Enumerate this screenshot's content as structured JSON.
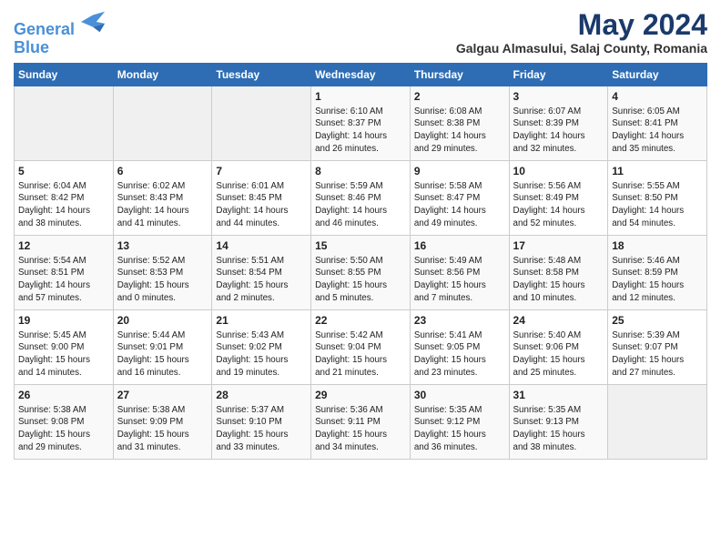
{
  "header": {
    "logo_line1": "General",
    "logo_line2": "Blue",
    "title": "May 2024",
    "subtitle": "Galgau Almasului, Salaj County, Romania"
  },
  "days_of_week": [
    "Sunday",
    "Monday",
    "Tuesday",
    "Wednesday",
    "Thursday",
    "Friday",
    "Saturday"
  ],
  "weeks": [
    [
      {
        "day": "",
        "detail": ""
      },
      {
        "day": "",
        "detail": ""
      },
      {
        "day": "",
        "detail": ""
      },
      {
        "day": "1",
        "detail": "Sunrise: 6:10 AM\nSunset: 8:37 PM\nDaylight: 14 hours\nand 26 minutes."
      },
      {
        "day": "2",
        "detail": "Sunrise: 6:08 AM\nSunset: 8:38 PM\nDaylight: 14 hours\nand 29 minutes."
      },
      {
        "day": "3",
        "detail": "Sunrise: 6:07 AM\nSunset: 8:39 PM\nDaylight: 14 hours\nand 32 minutes."
      },
      {
        "day": "4",
        "detail": "Sunrise: 6:05 AM\nSunset: 8:41 PM\nDaylight: 14 hours\nand 35 minutes."
      }
    ],
    [
      {
        "day": "5",
        "detail": "Sunrise: 6:04 AM\nSunset: 8:42 PM\nDaylight: 14 hours\nand 38 minutes."
      },
      {
        "day": "6",
        "detail": "Sunrise: 6:02 AM\nSunset: 8:43 PM\nDaylight: 14 hours\nand 41 minutes."
      },
      {
        "day": "7",
        "detail": "Sunrise: 6:01 AM\nSunset: 8:45 PM\nDaylight: 14 hours\nand 44 minutes."
      },
      {
        "day": "8",
        "detail": "Sunrise: 5:59 AM\nSunset: 8:46 PM\nDaylight: 14 hours\nand 46 minutes."
      },
      {
        "day": "9",
        "detail": "Sunrise: 5:58 AM\nSunset: 8:47 PM\nDaylight: 14 hours\nand 49 minutes."
      },
      {
        "day": "10",
        "detail": "Sunrise: 5:56 AM\nSunset: 8:49 PM\nDaylight: 14 hours\nand 52 minutes."
      },
      {
        "day": "11",
        "detail": "Sunrise: 5:55 AM\nSunset: 8:50 PM\nDaylight: 14 hours\nand 54 minutes."
      }
    ],
    [
      {
        "day": "12",
        "detail": "Sunrise: 5:54 AM\nSunset: 8:51 PM\nDaylight: 14 hours\nand 57 minutes."
      },
      {
        "day": "13",
        "detail": "Sunrise: 5:52 AM\nSunset: 8:53 PM\nDaylight: 15 hours\nand 0 minutes."
      },
      {
        "day": "14",
        "detail": "Sunrise: 5:51 AM\nSunset: 8:54 PM\nDaylight: 15 hours\nand 2 minutes."
      },
      {
        "day": "15",
        "detail": "Sunrise: 5:50 AM\nSunset: 8:55 PM\nDaylight: 15 hours\nand 5 minutes."
      },
      {
        "day": "16",
        "detail": "Sunrise: 5:49 AM\nSunset: 8:56 PM\nDaylight: 15 hours\nand 7 minutes."
      },
      {
        "day": "17",
        "detail": "Sunrise: 5:48 AM\nSunset: 8:58 PM\nDaylight: 15 hours\nand 10 minutes."
      },
      {
        "day": "18",
        "detail": "Sunrise: 5:46 AM\nSunset: 8:59 PM\nDaylight: 15 hours\nand 12 minutes."
      }
    ],
    [
      {
        "day": "19",
        "detail": "Sunrise: 5:45 AM\nSunset: 9:00 PM\nDaylight: 15 hours\nand 14 minutes."
      },
      {
        "day": "20",
        "detail": "Sunrise: 5:44 AM\nSunset: 9:01 PM\nDaylight: 15 hours\nand 16 minutes."
      },
      {
        "day": "21",
        "detail": "Sunrise: 5:43 AM\nSunset: 9:02 PM\nDaylight: 15 hours\nand 19 minutes."
      },
      {
        "day": "22",
        "detail": "Sunrise: 5:42 AM\nSunset: 9:04 PM\nDaylight: 15 hours\nand 21 minutes."
      },
      {
        "day": "23",
        "detail": "Sunrise: 5:41 AM\nSunset: 9:05 PM\nDaylight: 15 hours\nand 23 minutes."
      },
      {
        "day": "24",
        "detail": "Sunrise: 5:40 AM\nSunset: 9:06 PM\nDaylight: 15 hours\nand 25 minutes."
      },
      {
        "day": "25",
        "detail": "Sunrise: 5:39 AM\nSunset: 9:07 PM\nDaylight: 15 hours\nand 27 minutes."
      }
    ],
    [
      {
        "day": "26",
        "detail": "Sunrise: 5:38 AM\nSunset: 9:08 PM\nDaylight: 15 hours\nand 29 minutes."
      },
      {
        "day": "27",
        "detail": "Sunrise: 5:38 AM\nSunset: 9:09 PM\nDaylight: 15 hours\nand 31 minutes."
      },
      {
        "day": "28",
        "detail": "Sunrise: 5:37 AM\nSunset: 9:10 PM\nDaylight: 15 hours\nand 33 minutes."
      },
      {
        "day": "29",
        "detail": "Sunrise: 5:36 AM\nSunset: 9:11 PM\nDaylight: 15 hours\nand 34 minutes."
      },
      {
        "day": "30",
        "detail": "Sunrise: 5:35 AM\nSunset: 9:12 PM\nDaylight: 15 hours\nand 36 minutes."
      },
      {
        "day": "31",
        "detail": "Sunrise: 5:35 AM\nSunset: 9:13 PM\nDaylight: 15 hours\nand 38 minutes."
      },
      {
        "day": "",
        "detail": ""
      }
    ]
  ]
}
